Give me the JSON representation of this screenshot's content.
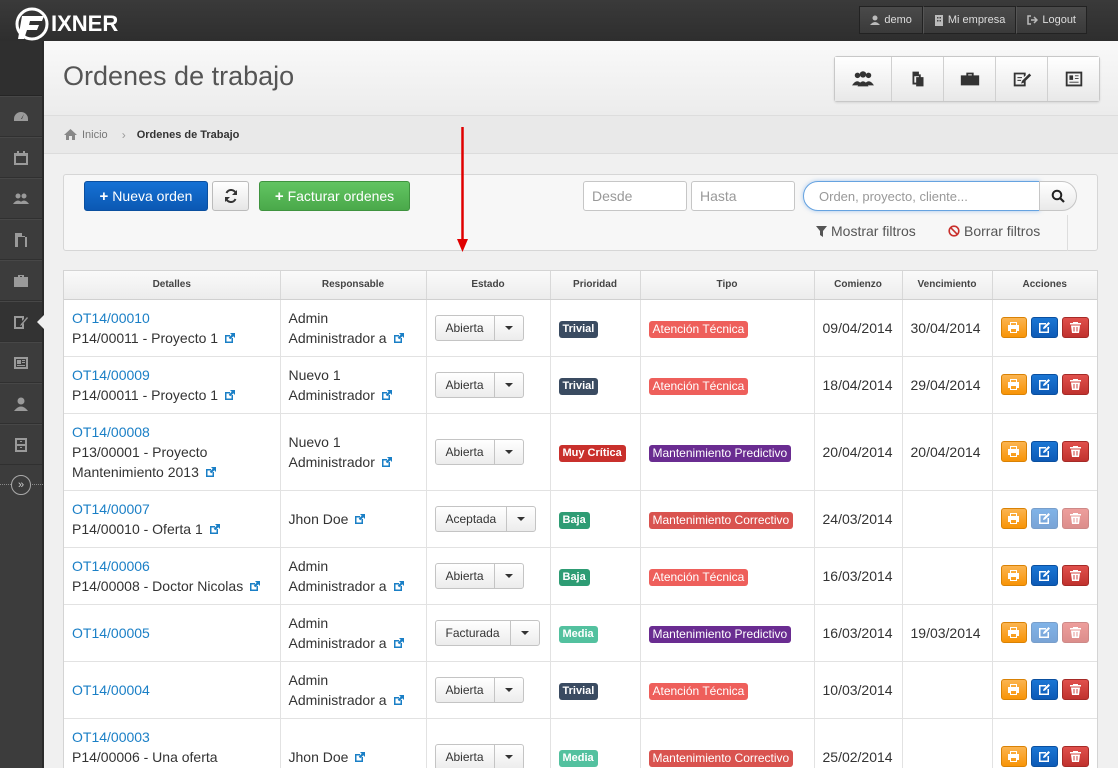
{
  "app": {
    "logo_text": "IXNER"
  },
  "userbar": {
    "user": "demo",
    "company": "Mi empresa",
    "logout": "Logout"
  },
  "page": {
    "title": "Ordenes de trabajo"
  },
  "breadcrumb": {
    "home": "Inicio",
    "current": "Ordenes de Trabajo"
  },
  "toolbar": {
    "new_order": "Nueva orden",
    "invoice_orders": "Facturar ordenes",
    "desde_placeholder": "Desde",
    "hasta_placeholder": "Hasta",
    "search_placeholder": "Orden, proyecto, cliente...",
    "show_filters": "Mostrar filtros",
    "clear_filters": "Borrar filtros"
  },
  "table": {
    "headers": [
      "Detalles",
      "Responsable",
      "Estado",
      "Prioridad",
      "Tipo",
      "Comienzo",
      "Vencimiento",
      "Acciones"
    ],
    "rows": [
      {
        "order": "OT14/00010",
        "project": "P14/00011 - Proyecto 1",
        "resp1": "Admin",
        "resp2": "Administrador a",
        "estado": "Abierta",
        "prioridad": "Trivial",
        "tipo": "Atención Técnica",
        "comienzo": "09/04/2014",
        "vencimiento": "30/04/2014"
      },
      {
        "order": "OT14/00009",
        "project": "P14/00011 - Proyecto 1",
        "resp1": "Nuevo 1",
        "resp2": "Administrador",
        "estado": "Abierta",
        "prioridad": "Trivial",
        "tipo": "Atención Técnica",
        "comienzo": "18/04/2014",
        "vencimiento": "29/04/2014"
      },
      {
        "order": "OT14/00008",
        "project_l1": "P13/00001 - Proyecto",
        "project_l2": "Mantenimiento 2013",
        "resp1": "Nuevo 1",
        "resp2": "Administrador",
        "estado": "Abierta",
        "prioridad": "Muy Crítica",
        "tipo": "Mantenimiento Predictivo",
        "comienzo": "20/04/2014",
        "vencimiento": "20/04/2014"
      },
      {
        "order": "OT14/00007",
        "project": "P14/00010 - Oferta 1",
        "resp1": "Jhon Doe",
        "estado": "Aceptada",
        "prioridad": "Baja",
        "tipo": "Mantenimiento Correctivo",
        "comienzo": "24/03/2014",
        "vencimiento": ""
      },
      {
        "order": "OT14/00006",
        "project": "P14/00008 - Doctor Nicolas",
        "resp1": "Admin",
        "resp2": "Administrador a",
        "estado": "Abierta",
        "prioridad": "Baja",
        "tipo": "Atención Técnica",
        "comienzo": "16/03/2014",
        "vencimiento": ""
      },
      {
        "order": "OT14/00005",
        "resp1": "Admin",
        "resp2": "Administrador a",
        "estado": "Facturada",
        "prioridad": "Media",
        "tipo": "Mantenimiento Predictivo",
        "comienzo": "16/03/2014",
        "vencimiento": "19/03/2014"
      },
      {
        "order": "OT14/00004",
        "resp1": "Admin",
        "resp2": "Administrador a",
        "estado": "Abierta",
        "prioridad": "Trivial",
        "tipo": "Atención Técnica",
        "comienzo": "10/03/2014",
        "vencimiento": ""
      },
      {
        "order": "OT14/00003",
        "project": "P14/00006 - Una oferta",
        "resp1": "Jhon Doe",
        "estado": "Abierta",
        "prioridad": "Media",
        "tipo": "Mantenimiento Correctivo",
        "comienzo": "25/02/2014",
        "vencimiento": ""
      }
    ]
  },
  "colors": {
    "primary": "#0b58b3",
    "success": "#4aa94a",
    "annotation_arrow": "#e00000"
  }
}
